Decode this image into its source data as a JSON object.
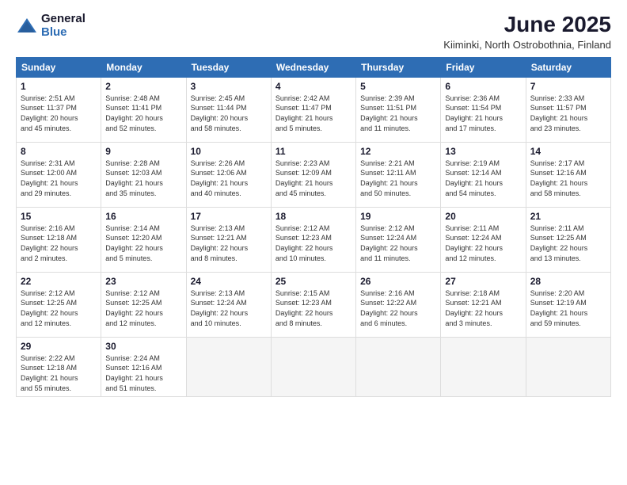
{
  "logo": {
    "general": "General",
    "blue": "Blue"
  },
  "title": "June 2025",
  "location": "Kiiminki, North Ostrobothnia, Finland",
  "days_of_week": [
    "Sunday",
    "Monday",
    "Tuesday",
    "Wednesday",
    "Thursday",
    "Friday",
    "Saturday"
  ],
  "weeks": [
    [
      {
        "day": "1",
        "info": "Sunrise: 2:51 AM\nSunset: 11:37 PM\nDaylight: 20 hours\nand 45 minutes."
      },
      {
        "day": "2",
        "info": "Sunrise: 2:48 AM\nSunset: 11:41 PM\nDaylight: 20 hours\nand 52 minutes."
      },
      {
        "day": "3",
        "info": "Sunrise: 2:45 AM\nSunset: 11:44 PM\nDaylight: 20 hours\nand 58 minutes."
      },
      {
        "day": "4",
        "info": "Sunrise: 2:42 AM\nSunset: 11:47 PM\nDaylight: 21 hours\nand 5 minutes."
      },
      {
        "day": "5",
        "info": "Sunrise: 2:39 AM\nSunset: 11:51 PM\nDaylight: 21 hours\nand 11 minutes."
      },
      {
        "day": "6",
        "info": "Sunrise: 2:36 AM\nSunset: 11:54 PM\nDaylight: 21 hours\nand 17 minutes."
      },
      {
        "day": "7",
        "info": "Sunrise: 2:33 AM\nSunset: 11:57 PM\nDaylight: 21 hours\nand 23 minutes."
      }
    ],
    [
      {
        "day": "8",
        "info": "Sunrise: 2:31 AM\nSunset: 12:00 AM\nDaylight: 21 hours\nand 29 minutes."
      },
      {
        "day": "9",
        "info": "Sunrise: 2:28 AM\nSunset: 12:03 AM\nDaylight: 21 hours\nand 35 minutes."
      },
      {
        "day": "10",
        "info": "Sunrise: 2:26 AM\nSunset: 12:06 AM\nDaylight: 21 hours\nand 40 minutes."
      },
      {
        "day": "11",
        "info": "Sunrise: 2:23 AM\nSunset: 12:09 AM\nDaylight: 21 hours\nand 45 minutes."
      },
      {
        "day": "12",
        "info": "Sunrise: 2:21 AM\nSunset: 12:11 AM\nDaylight: 21 hours\nand 50 minutes."
      },
      {
        "day": "13",
        "info": "Sunrise: 2:19 AM\nSunset: 12:14 AM\nDaylight: 21 hours\nand 54 minutes."
      },
      {
        "day": "14",
        "info": "Sunrise: 2:17 AM\nSunset: 12:16 AM\nDaylight: 21 hours\nand 58 minutes."
      }
    ],
    [
      {
        "day": "15",
        "info": "Sunrise: 2:16 AM\nSunset: 12:18 AM\nDaylight: 22 hours\nand 2 minutes."
      },
      {
        "day": "16",
        "info": "Sunrise: 2:14 AM\nSunset: 12:20 AM\nDaylight: 22 hours\nand 5 minutes."
      },
      {
        "day": "17",
        "info": "Sunrise: 2:13 AM\nSunset: 12:21 AM\nDaylight: 22 hours\nand 8 minutes."
      },
      {
        "day": "18",
        "info": "Sunrise: 2:12 AM\nSunset: 12:23 AM\nDaylight: 22 hours\nand 10 minutes."
      },
      {
        "day": "19",
        "info": "Sunrise: 2:12 AM\nSunset: 12:24 AM\nDaylight: 22 hours\nand 11 minutes."
      },
      {
        "day": "20",
        "info": "Sunrise: 2:11 AM\nSunset: 12:24 AM\nDaylight: 22 hours\nand 12 minutes."
      },
      {
        "day": "21",
        "info": "Sunrise: 2:11 AM\nSunset: 12:25 AM\nDaylight: 22 hours\nand 13 minutes."
      }
    ],
    [
      {
        "day": "22",
        "info": "Sunrise: 2:12 AM\nSunset: 12:25 AM\nDaylight: 22 hours\nand 12 minutes."
      },
      {
        "day": "23",
        "info": "Sunrise: 2:12 AM\nSunset: 12:25 AM\nDaylight: 22 hours\nand 12 minutes."
      },
      {
        "day": "24",
        "info": "Sunrise: 2:13 AM\nSunset: 12:24 AM\nDaylight: 22 hours\nand 10 minutes."
      },
      {
        "day": "25",
        "info": "Sunrise: 2:15 AM\nSunset: 12:23 AM\nDaylight: 22 hours\nand 8 minutes."
      },
      {
        "day": "26",
        "info": "Sunrise: 2:16 AM\nSunset: 12:22 AM\nDaylight: 22 hours\nand 6 minutes."
      },
      {
        "day": "27",
        "info": "Sunrise: 2:18 AM\nSunset: 12:21 AM\nDaylight: 22 hours\nand 3 minutes."
      },
      {
        "day": "28",
        "info": "Sunrise: 2:20 AM\nSunset: 12:19 AM\nDaylight: 21 hours\nand 59 minutes."
      }
    ],
    [
      {
        "day": "29",
        "info": "Sunrise: 2:22 AM\nSunset: 12:18 AM\nDaylight: 21 hours\nand 55 minutes."
      },
      {
        "day": "30",
        "info": "Sunrise: 2:24 AM\nSunset: 12:16 AM\nDaylight: 21 hours\nand 51 minutes."
      },
      {
        "day": "",
        "info": ""
      },
      {
        "day": "",
        "info": ""
      },
      {
        "day": "",
        "info": ""
      },
      {
        "day": "",
        "info": ""
      },
      {
        "day": "",
        "info": ""
      }
    ]
  ]
}
